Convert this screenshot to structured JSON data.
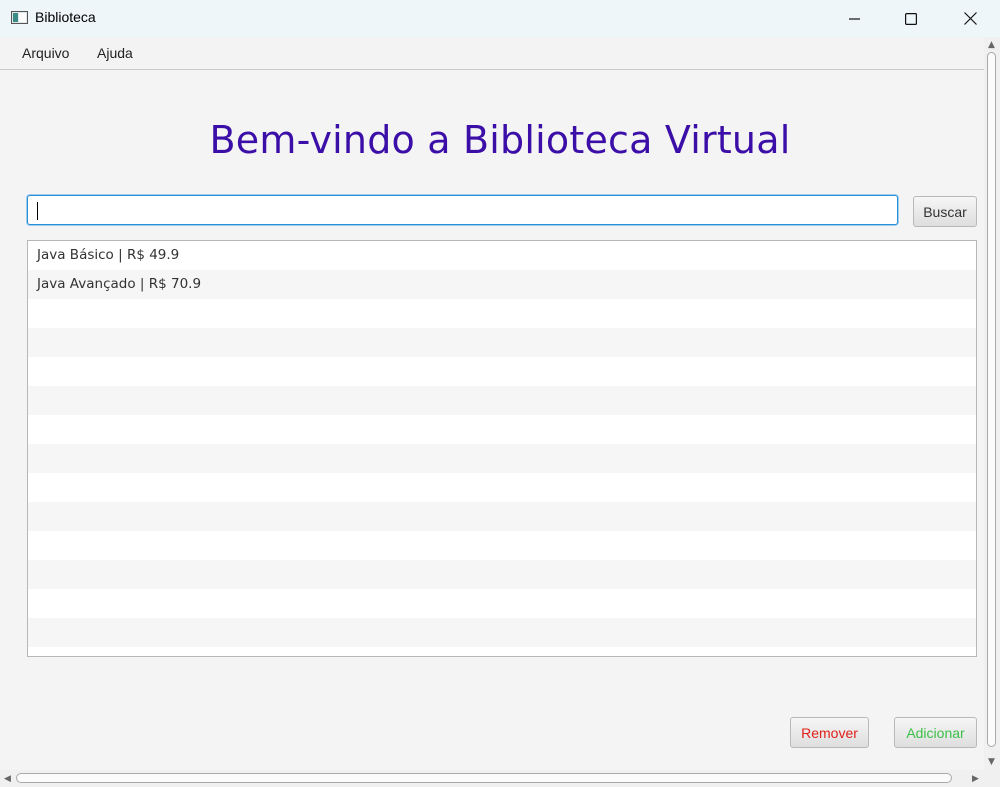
{
  "window": {
    "title": "Biblioteca",
    "icon": "app-window-icon"
  },
  "window_controls": {
    "minimize": "minimize-icon",
    "maximize": "maximize-icon",
    "close": "close-icon"
  },
  "menu": {
    "items": [
      {
        "label": "Arquivo"
      },
      {
        "label": "Ajuda"
      }
    ]
  },
  "heading": "Bem-vindo a Biblioteca Virtual",
  "search": {
    "value": "",
    "placeholder": "",
    "button_label": "Buscar"
  },
  "books": [
    {
      "text": "Java Básico | R$ 49.9"
    },
    {
      "text": "Java Avançado | R$ 70.9"
    }
  ],
  "actions": {
    "remove_label": "Remover",
    "add_label": "Adicionar"
  },
  "colors": {
    "heading": "#3c0ea8",
    "remove": "#e0201a",
    "add": "#3cc048",
    "focus": "#2a8fd6"
  }
}
